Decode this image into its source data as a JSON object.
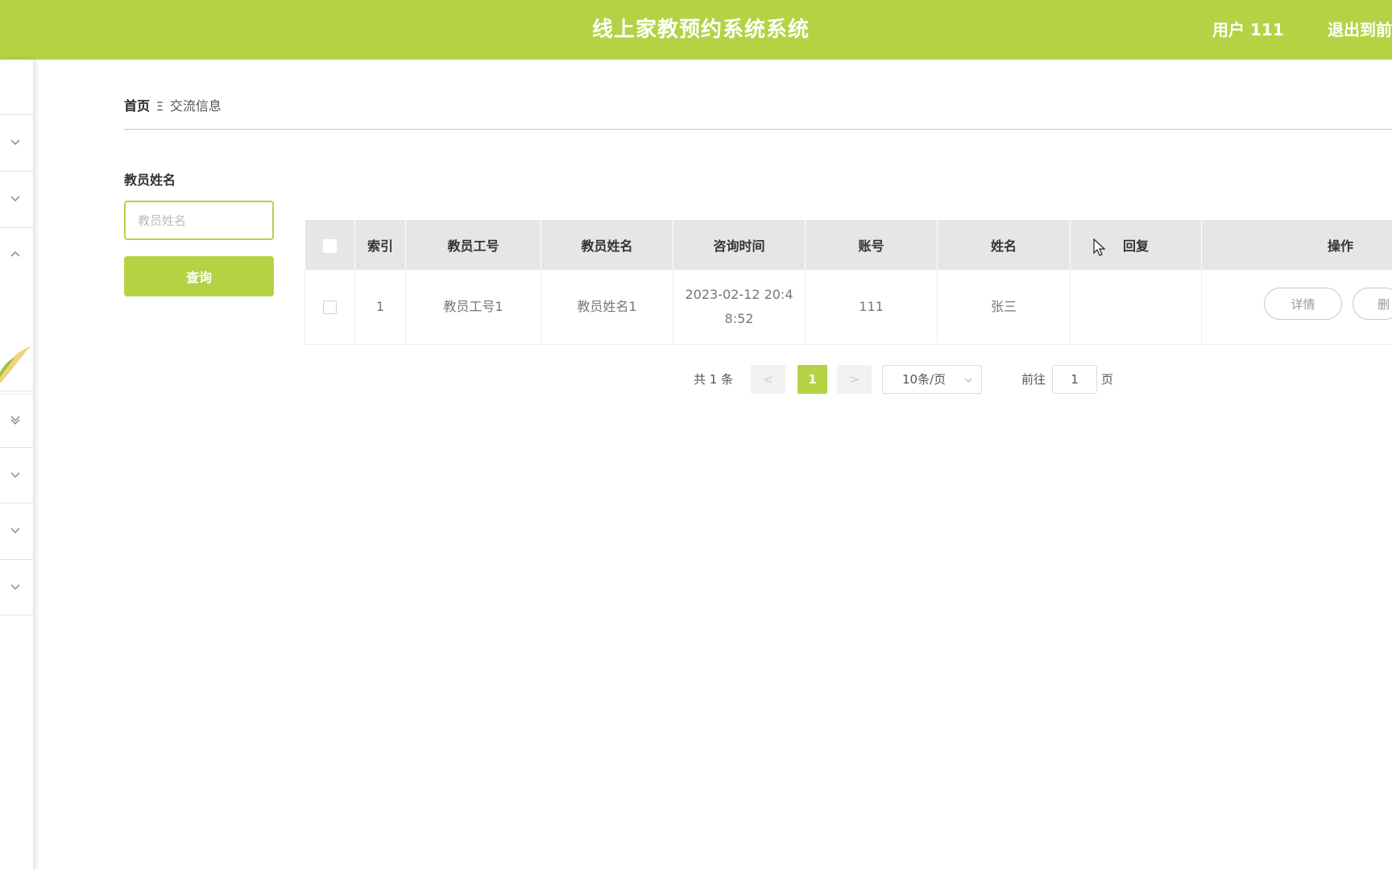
{
  "header": {
    "title": "线上家教预约系统系统",
    "user": "用户 111",
    "logout": "退出到前"
  },
  "breadcrumb": {
    "home": "首页",
    "separator": "Ξ",
    "current": "交流信息"
  },
  "search": {
    "label": "教员姓名",
    "placeholder": "教员姓名",
    "button": "查询"
  },
  "table": {
    "columns": [
      "索引",
      "教员工号",
      "教员姓名",
      "咨询时间",
      "账号",
      "姓名",
      "回复",
      "操作"
    ],
    "rows": [
      {
        "index": "1",
        "teacher_no": "教员工号1",
        "teacher_name": "教员姓名1",
        "time": "2023-02-12 20:48:52",
        "account": "111",
        "name": "张三",
        "reply": "",
        "actions": [
          "详情",
          "删"
        ]
      }
    ]
  },
  "pagination": {
    "total": "共 1 条",
    "prev": "<",
    "current": "1",
    "next": ">",
    "page_size": "10条/页",
    "goto_label": "前往",
    "goto_value": "1",
    "page_unit": "页"
  },
  "colors": {
    "accent": "#b5d245"
  },
  "icons": [
    "chevron-down-icon",
    "chevron-up-icon",
    "caret-down-icon",
    "mouse-cursor-icon"
  ]
}
